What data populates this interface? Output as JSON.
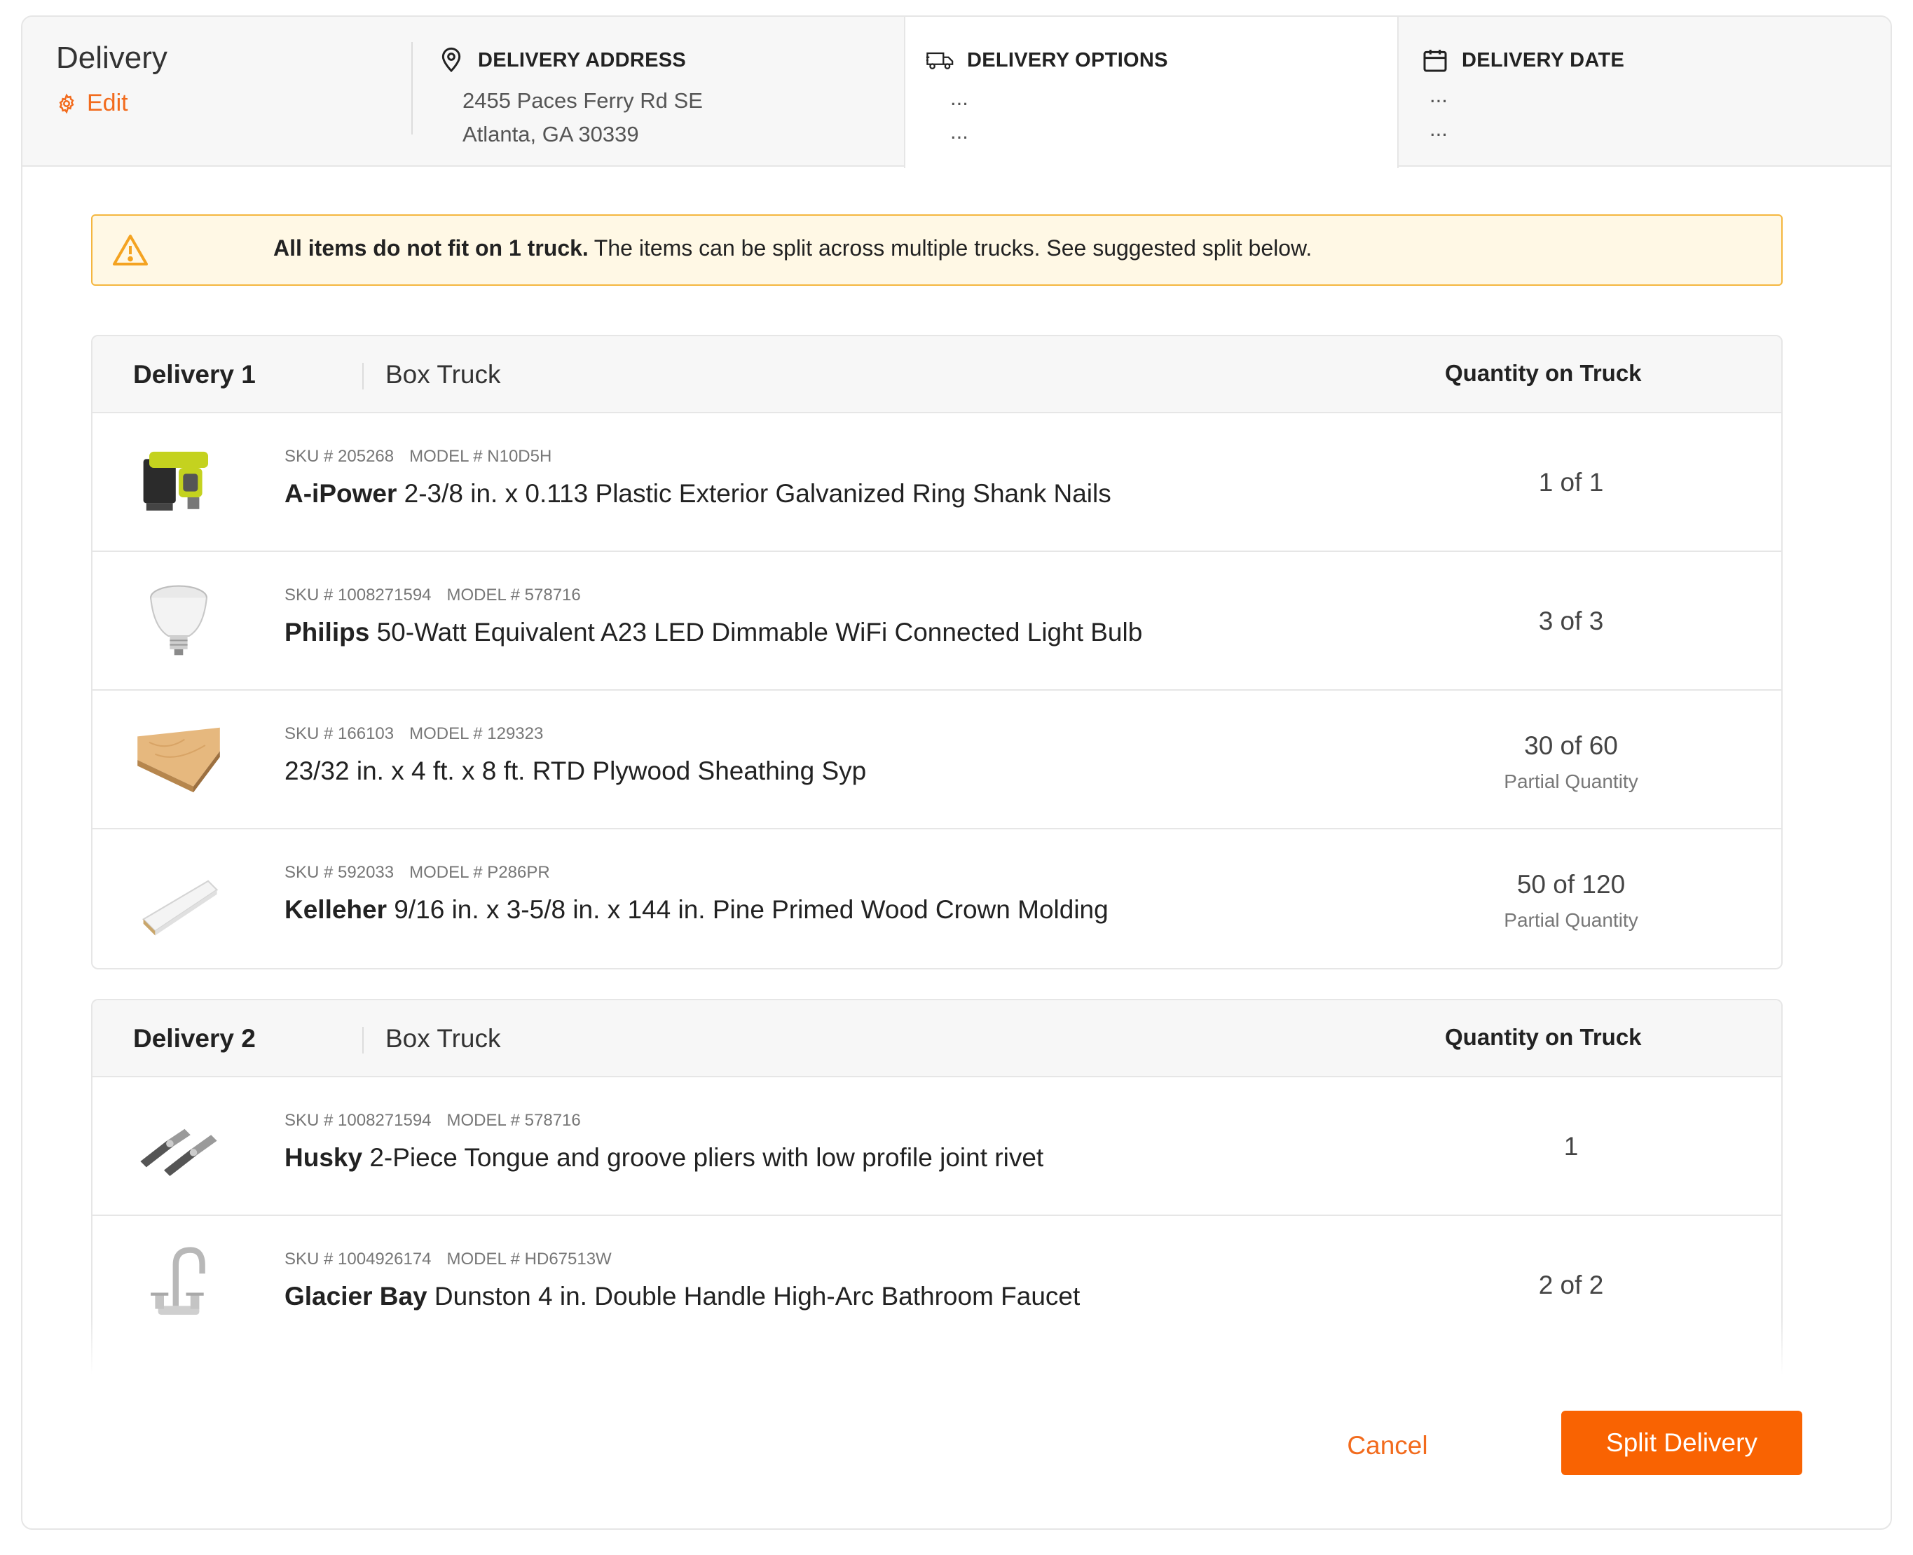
{
  "header": {
    "title": "Delivery",
    "edit_label": "Edit",
    "address": {
      "label": "DELIVERY ADDRESS",
      "line1": "2455 Paces Ferry Rd SE",
      "line2": "Atlanta, GA 30339"
    },
    "options": {
      "label": "DELIVERY OPTIONS",
      "line1": "...",
      "line2": "..."
    },
    "date": {
      "label": "DELIVERY DATE",
      "line1": "...",
      "line2": "..."
    }
  },
  "alert": {
    "bold": "All items do not fit on 1 truck.",
    "text": "The items can be split across multiple trucks. See suggested split below."
  },
  "deliveries": [
    {
      "name": "Delivery 1",
      "vehicle": "Box Truck",
      "qty_header": "Quantity on Truck",
      "items": [
        {
          "sku": "SKU # 205268",
          "model": "MODEL # N10D5H",
          "brand": "A-iPower",
          "desc": "2-3/8 in. x 0.113 Plastic Exterior Galvanized Ring Shank Nails",
          "qty": "1 of 1",
          "qty_note": "",
          "icon": "nail-gun-icon"
        },
        {
          "sku": "SKU # 1008271594",
          "model": "MODEL # 578716",
          "brand": "Philips",
          "desc": "50-Watt Equivalent A23 LED Dimmable WiFi Connected Light Bulb",
          "qty": "3 of 3",
          "qty_note": "",
          "icon": "light-bulb-icon"
        },
        {
          "sku": "SKU # 166103",
          "model": "MODEL # 129323",
          "brand": "",
          "desc": "23/32 in. x 4 ft. x 8 ft. RTD Plywood Sheathing Syp",
          "qty": "30 of 60",
          "qty_note": "Partial Quantity",
          "icon": "plywood-icon"
        },
        {
          "sku": "SKU # 592033",
          "model": "MODEL # P286PR",
          "brand": "Kelleher",
          "desc": "9/16 in. x 3-5/8 in. x 144 in. Pine Primed Wood Crown Molding",
          "qty": "50 of 120",
          "qty_note": "Partial Quantity",
          "icon": "molding-icon"
        }
      ]
    },
    {
      "name": "Delivery 2",
      "vehicle": "Box Truck",
      "qty_header": "Quantity on Truck",
      "items": [
        {
          "sku": "SKU # 1008271594",
          "model": "MODEL # 578716",
          "brand": "Husky",
          "desc": "2-Piece Tongue and groove pliers with low profile joint rivet",
          "qty": "1",
          "qty_note": "",
          "icon": "pliers-icon"
        },
        {
          "sku": "SKU # 1004926174",
          "model": "MODEL # HD67513W",
          "brand": "Glacier Bay",
          "desc": "Dunston 4 in. Double Handle High-Arc Bathroom Faucet",
          "qty": "2 of 2",
          "qty_note": "",
          "icon": "faucet-icon"
        }
      ]
    }
  ],
  "footer": {
    "cancel_label": "Cancel",
    "split_label": "Split Delivery"
  },
  "colors": {
    "accent": "#f96302",
    "link": "#f26b1d",
    "alert_bg": "#fff8e5",
    "alert_border": "#f4b63e"
  }
}
